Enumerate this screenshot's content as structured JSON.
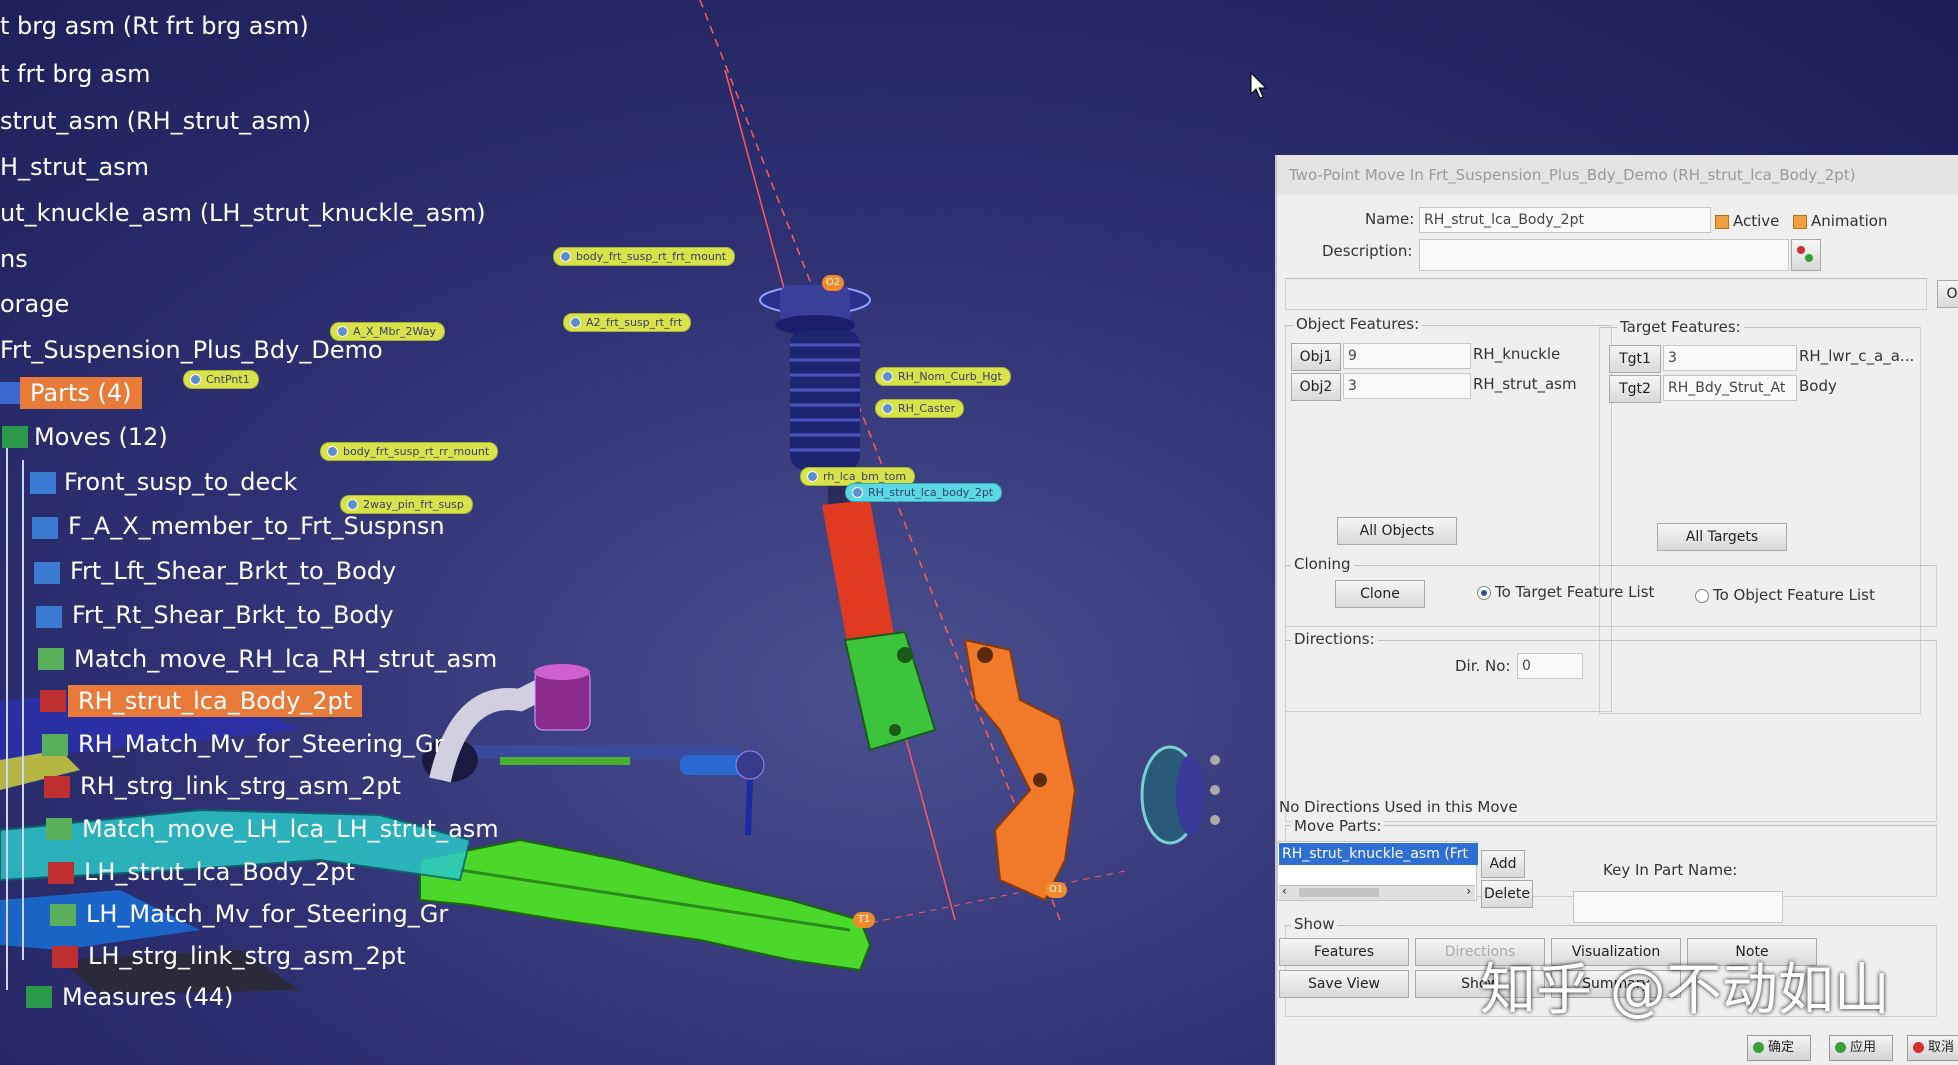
{
  "tree": {
    "items": [
      {
        "label": "t brg asm (Rt frt brg asm)"
      },
      {
        "label": "t frt brg asm"
      },
      {
        "label": "strut_asm (RH_strut_asm)"
      },
      {
        "label": "H_strut_asm"
      },
      {
        "label": "ut_knuckle_asm (LH_strut_knuckle_asm)"
      },
      {
        "label": "ns"
      },
      {
        "label": "orage"
      },
      {
        "label": "Frt_Suspension_Plus_Bdy_Demo"
      },
      {
        "label": "Parts (4)"
      },
      {
        "label": "Moves (12)"
      },
      {
        "label": "Front_susp_to_deck"
      },
      {
        "label": "F_A_X_member_to_Frt_Suspnsn"
      },
      {
        "label": "Frt_Lft_Shear_Brkt_to_Body"
      },
      {
        "label": "Frt_Rt_Shear_Brkt_to_Body"
      },
      {
        "label": "Match_move_RH_lca_RH_strut_asm"
      },
      {
        "label": "RH_strut_lca_Body_2pt"
      },
      {
        "label": "RH_Match_Mv_for_Steering_Gr"
      },
      {
        "label": "RH_strg_link_strg_asm_2pt"
      },
      {
        "label": "Match_move_LH_lca_LH_strut_asm"
      },
      {
        "label": "LH_strut_lca_Body_2pt"
      },
      {
        "label": "LH_Match_Mv_for_Steering_Gr"
      },
      {
        "label": "LH_strg_link_strg_asm_2pt"
      },
      {
        "label": "Measures (44)"
      }
    ]
  },
  "model_labels": [
    {
      "text": "body_frt_susp_rt_frt_mount"
    },
    {
      "text": "A2_frt_susp_rt_frt"
    },
    {
      "text": "A_X_Mbr_2Way"
    },
    {
      "text": "CntPnt1"
    },
    {
      "text": "body_frt_susp_rt_rr_mount"
    },
    {
      "text": "2way_pin_frt_susp"
    },
    {
      "text": "RH_Nom_Curb_Hgt"
    },
    {
      "text": "RH_Caster"
    },
    {
      "text": "rh_lca_bm_tom"
    },
    {
      "text": "RH_strut_lca_body_2pt"
    }
  ],
  "markers": [
    {
      "text": "O2"
    },
    {
      "text": "O1"
    },
    {
      "text": "T1"
    }
  ],
  "dialog": {
    "title": "Two-Point Move In Frt_Suspension_Plus_Bdy_Demo (RH_strut_lca_Body_2pt)",
    "name_label": "Name:",
    "name_value": "RH_strut_lca_Body_2pt",
    "active_label": "Active",
    "animation_label": "Animation",
    "description_label": "Description:",
    "description_value": "",
    "object_features_label": "Object Features:",
    "target_features_label": "Target Features:",
    "obj1_button": "Obj1",
    "obj1_value": "9",
    "obj1_name": "RH_knuckle",
    "obj2_button": "Obj2",
    "obj2_value": "3",
    "obj2_name": "RH_strut_asm",
    "tgt1_button": "Tgt1",
    "tgt1_value": "3",
    "tgt1_name": "RH_lwr_c_a_a...",
    "tgt2_button": "Tgt2",
    "tgt2_value": "RH_Bdy_Strut_At",
    "tgt2_name": "Body",
    "all_objects_button": "All Objects",
    "all_targets_button": "All Targets",
    "cloning_label": "Cloning",
    "clone_button": "Clone",
    "to_target_label": "To Target Feature List",
    "to_object_label": "To Object Feature List",
    "directions_label": "Directions:",
    "dir_no_label": "Dir. No:",
    "dir_no_value": "0",
    "no_directions_text": "No Directions Used in this Move",
    "move_parts_label": "Move Parts:",
    "move_parts_item": "RH_strut_knuckle_asm (Frt",
    "add_button": "Add",
    "delete_button": "Delete",
    "key_in_label": "Key In Part Name:",
    "key_in_value": "",
    "show_label": "Show",
    "features_button": "Features",
    "directions_button": "Directions",
    "save_view_button": "Save View",
    "show_button": "Show",
    "summary_button": "Summary",
    "visualization_button": "Visualization",
    "note_button": "Note",
    "ok_button": "确定",
    "apply_button": "应用",
    "cancel_button": "取消",
    "o_button": "O"
  },
  "watermark": "知乎 @不动如山",
  "colors": {
    "viewport_bg": "#2e3173",
    "highlight": "#e87a3a",
    "label_yellow": "#d8e34a",
    "label_cyan": "#5ad8e6",
    "selection_blue": "#2f6fd1"
  }
}
